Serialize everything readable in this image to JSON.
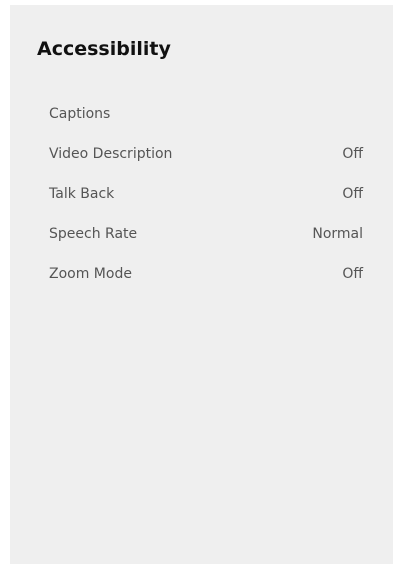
{
  "screen": {
    "title": "Accessibility"
  },
  "menu": {
    "items": [
      {
        "label": "Captions",
        "value": ""
      },
      {
        "label": "Video Description",
        "value": "Off"
      },
      {
        "label": "Talk Back",
        "value": "Off"
      },
      {
        "label": "Speech Rate",
        "value": "Normal"
      },
      {
        "label": "Zoom Mode",
        "value": "Off"
      }
    ]
  },
  "colors": {
    "panel_background": "#efefef",
    "title_text": "#111111",
    "item_text": "#555555"
  }
}
